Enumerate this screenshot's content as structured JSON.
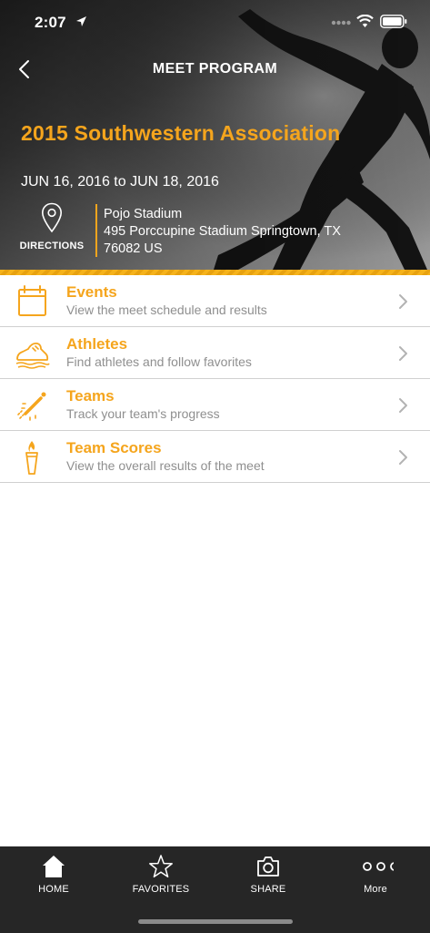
{
  "status_bar": {
    "time": "2:07"
  },
  "nav": {
    "title": "MEET PROGRAM"
  },
  "meet": {
    "title": "2015 Southwestern Association",
    "dates": "JUN 16, 2016 to JUN 18, 2016",
    "directions_label": "DIRECTIONS",
    "venue_name": "Pojo Stadium",
    "venue_address_line1": "495 Porccupine Stadium Springtown, TX",
    "venue_address_line2": "76082 US"
  },
  "menu": {
    "items": [
      {
        "icon": "calendar-icon",
        "title": "Events",
        "subtitle": "View the meet schedule and results"
      },
      {
        "icon": "running-shoe-icon",
        "title": "Athletes",
        "subtitle": "Find athletes and follow favorites"
      },
      {
        "icon": "relay-baton-icon",
        "title": "Teams",
        "subtitle": "Track your team's progress"
      },
      {
        "icon": "torch-icon",
        "title": "Team Scores",
        "subtitle": "View the overall results of the meet"
      }
    ]
  },
  "tabs": [
    {
      "icon": "home-icon",
      "label": "HOME"
    },
    {
      "icon": "star-icon",
      "label": "FAVORITES"
    },
    {
      "icon": "camera-icon",
      "label": "SHARE"
    },
    {
      "icon": "more-dots-icon",
      "label": "More"
    }
  ],
  "colors": {
    "accent": "#f5a51d",
    "tab_bar": "#262626",
    "subtitle_text": "#8f8f8f",
    "divider": "#d0d0d0"
  }
}
